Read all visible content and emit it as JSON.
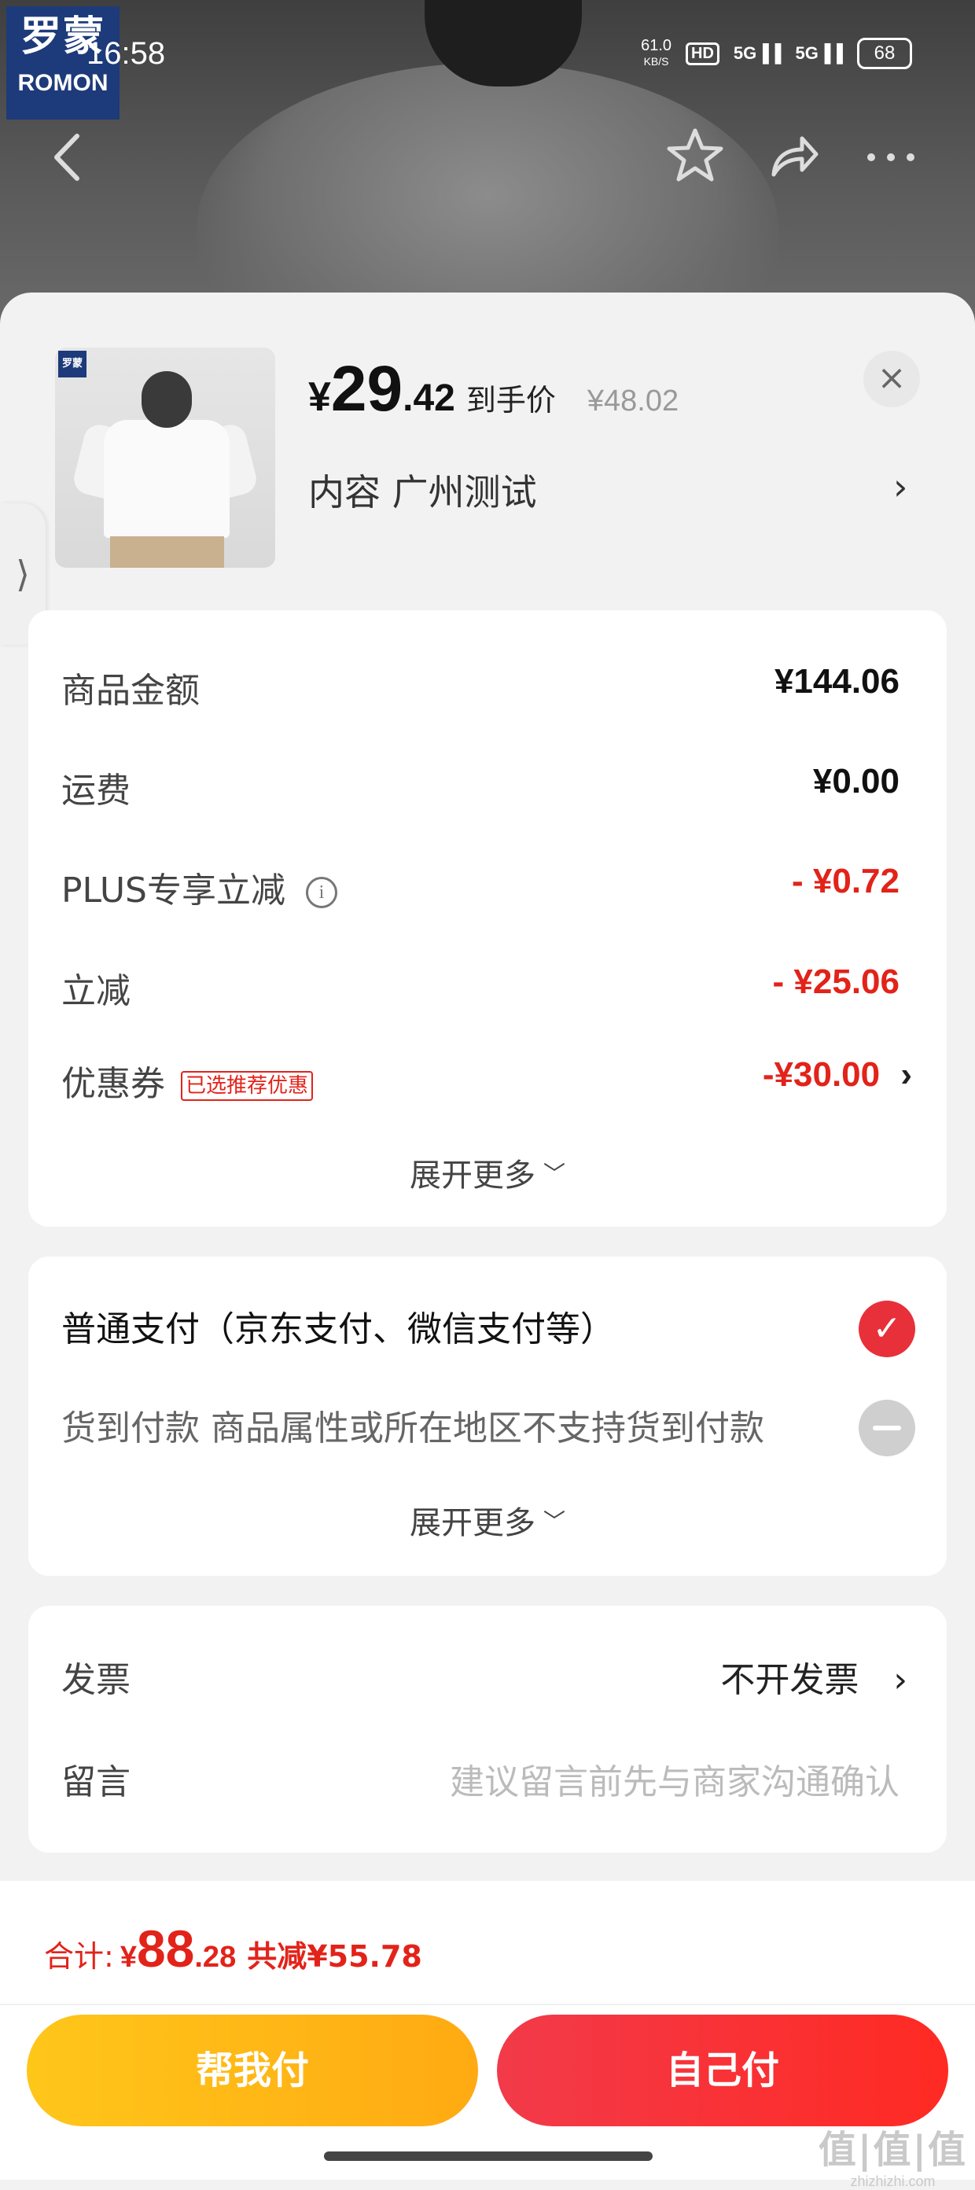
{
  "status_bar": {
    "time": "16:58",
    "net_speed_value": "61.0",
    "net_speed_unit": "KB/S",
    "hd": "HD",
    "signal1": "5G",
    "signal2": "5G",
    "battery": "68"
  },
  "brand_logo": {
    "cn": "罗蒙",
    "en": "ROMON"
  },
  "product": {
    "thumb_logo": "罗蒙",
    "price_symbol": "¥",
    "price_int": "29",
    "price_dec": ".42",
    "price_tag": "到手价",
    "original_price": "¥48.02",
    "spec": "内容  广州测试",
    "spec_arrow": "›",
    "close": "×"
  },
  "summary": {
    "rows": [
      {
        "label": "商品金额",
        "value": "¥144.06"
      },
      {
        "label": "运费",
        "value": "¥0.00"
      },
      {
        "label": "PLUS专享立减",
        "value": "- ¥0.72",
        "info": "i"
      },
      {
        "label": "立减",
        "value": "- ¥25.06"
      },
      {
        "label": "优惠券",
        "badge": "已选推荐优惠",
        "value": "-¥30.00",
        "arrow": "›"
      }
    ],
    "expand": "展开更多",
    "caret": "﹀"
  },
  "payment": {
    "options": [
      {
        "label": "普通支付（京东支付、微信支付等）",
        "mark": "✓",
        "selected": true
      },
      {
        "label": "货到付款 商品属性或所在地区不支持货到付款",
        "selected": false
      }
    ],
    "expand": "展开更多",
    "caret": "﹀"
  },
  "extras": {
    "invoice_label": "发票",
    "invoice_value": "不开发票",
    "invoice_arrow": "›",
    "message_label": "留言",
    "message_placeholder": "建议留言前先与商家沟通确认"
  },
  "footer": {
    "total_label": "合计:",
    "total_symbol": "¥",
    "total_int": "88",
    "total_dec": ".28",
    "total_save": "共减¥55.78",
    "btn_help": "帮我付",
    "btn_self": "自己付"
  },
  "watermark": {
    "line1": "值|值|值",
    "line2": "zhizhizhi.com"
  },
  "colors": {
    "accent_red": "#e2231a",
    "help_yellow": "#ffb81a",
    "pay_red": "#f2303a"
  }
}
